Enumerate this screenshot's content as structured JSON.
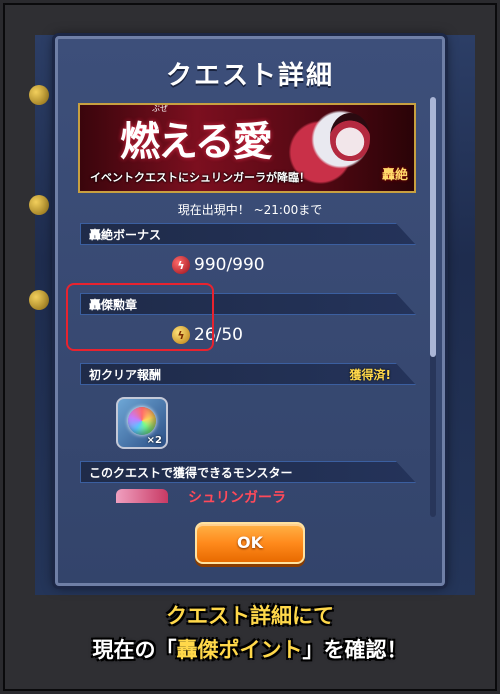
{
  "dialog": {
    "title": "クエスト詳細",
    "ok_label": "OK"
  },
  "banner": {
    "title": "燃える愛",
    "title_ruby": "ぶぜ",
    "subtitle": "イベントクエストにシュリンガーラが降臨！",
    "badge": "轟絶"
  },
  "event_time": "現在出現中！ ~21:00まで",
  "sections": {
    "bonus": {
      "label": "轟絶ボーナス",
      "value": "990/990",
      "icon": "red-lightning-icon"
    },
    "medal": {
      "label": "轟傑勲章",
      "value": "26/50",
      "icon": "gold-lightning-icon"
    },
    "first_clear": {
      "label": "初クリア報酬",
      "status": "獲得済!",
      "reward_qty": "×2",
      "reward_icon": "rainbow-orb-icon"
    },
    "monsters": {
      "label": "このクエストで獲得できるモンスター",
      "name": "シュリンガーラ"
    }
  },
  "caption": {
    "line1": "クエスト詳細にて",
    "line2_prefix": "現在の「",
    "line2_highlight": "轟傑ポイント",
    "line2_suffix": "」を確認！"
  },
  "colors": {
    "highlight_box": "#e8232f",
    "ok_button": "#ff8a1c",
    "caption_accent": "#ffd84a"
  }
}
